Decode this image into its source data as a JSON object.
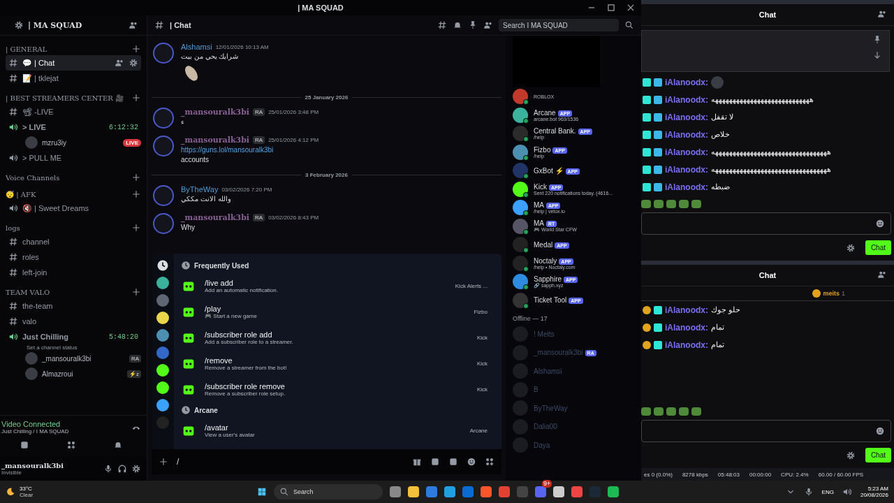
{
  "window": {
    "title": "| MA SQUAD"
  },
  "server": {
    "name": "| MA SQUAD"
  },
  "sidebar": {
    "sections": [
      {
        "label": "| GENERAL",
        "channels": [
          {
            "kind": "text",
            "name": "💬 | Chat",
            "selected": true
          },
          {
            "kind": "text",
            "name": "📝 | tklejat",
            "selected": false
          }
        ]
      },
      {
        "label": "| BEST STREAMERS CENTER 🎥",
        "channels": [
          {
            "kind": "text",
            "name": "📽 -LIVE",
            "selected": false
          },
          {
            "kind": "voice",
            "name": "> LIVE",
            "active": true,
            "timer": "6:12:32",
            "users": [
              {
                "name": "mzru3iy",
                "live": "LIVE"
              }
            ]
          },
          {
            "kind": "voice",
            "name": "> PULL ME",
            "active": false
          }
        ]
      },
      {
        "label": "Voice Channels"
      },
      {
        "label": "😴 | AFK",
        "channels": [
          {
            "kind": "voice",
            "name": "🔇 | Sweet Dreams",
            "active": false
          }
        ]
      },
      {
        "label": "logs",
        "channels": [
          {
            "kind": "text",
            "name": "channel",
            "selected": false
          },
          {
            "kind": "text",
            "name": "roles",
            "selected": false
          },
          {
            "kind": "text",
            "name": "left-join",
            "selected": false
          }
        ]
      },
      {
        "label": "TEAM VALO",
        "channels": [
          {
            "kind": "text",
            "name": "the-team",
            "selected": false
          },
          {
            "kind": "text",
            "name": "valo",
            "selected": false
          },
          {
            "kind": "voice",
            "name": "Just Chilling",
            "active": true,
            "timer": "5:48:20",
            "status": "Set a channel status",
            "users": [
              {
                "name": "_mansouralk3bi",
                "tag": "RA"
              },
              {
                "name": "Almazroui",
                "tag": "⚡z"
              }
            ]
          }
        ]
      }
    ]
  },
  "voice_panel": {
    "status": "Video Connected",
    "location": "Just Chilling / I MA SQUAD"
  },
  "user_panel": {
    "name": "_mansouralk3bi",
    "status": "Invisible"
  },
  "header": {
    "channel": "| Chat",
    "search": {
      "placeholder": "Search I MA SQUAD"
    }
  },
  "messages": [
    {
      "kind": "message",
      "author": "Alshamsi",
      "time": "12/01/2026 10:13 AM",
      "lines": [
        "شرايك يحي من بيت"
      ],
      "sticker": true
    },
    {
      "kind": "divider",
      "label": "25 January 2026"
    },
    {
      "kind": "message",
      "author": "_mansouralk3bi",
      "tag": "RA",
      "time": "25/01/2026 3:48 PM",
      "lines": [
        "ء"
      ]
    },
    {
      "kind": "message",
      "author": "_mansouralk3bi",
      "tag": "RA",
      "time": "25/01/2026 4:12 PM",
      "link": "https://guns.lol/mansouralk3bi",
      "lines": [
        "accounts"
      ]
    },
    {
      "kind": "divider",
      "label": "3 February 2026"
    },
    {
      "kind": "message",
      "author": "ByTheWay",
      "time": "03/02/2026 7:20 PM",
      "lines": [
        "والله الانت مككي"
      ]
    },
    {
      "kind": "message",
      "author": "_mansouralk3bi",
      "tag": "RA",
      "time": "03/02/2026 8:43 PM",
      "lines": [
        "Why"
      ]
    }
  ],
  "commands": {
    "sections": [
      {
        "title": "Frequently Used",
        "items": [
          {
            "name": "/live add",
            "description": "Add an automatic notification.",
            "source": "Kick Alerts ..."
          },
          {
            "name": "/play",
            "description": "🎮 Start a new game",
            "source": "Fizbo"
          },
          {
            "name": "/subscriber role add",
            "description": "Add a subscriber role to a streamer.",
            "source": "Kick"
          },
          {
            "name": "/remove",
            "description": "Remove a streamer from the bot!",
            "source": "Kick"
          },
          {
            "name": "/subscriber role remove",
            "description": "Remove a subscriber role setup.",
            "source": "Kick"
          }
        ]
      },
      {
        "title": "Arcane",
        "items": [
          {
            "name": "/avatar",
            "description": "View a user's avatar",
            "source": "Arcane"
          }
        ]
      }
    ]
  },
  "composer": {
    "value": "/"
  },
  "members": {
    "online": [
      {
        "activity": "ROBLOX"
      },
      {
        "name": "Arcane",
        "badge": "APP",
        "activity": "arcane.bot 963/1536"
      },
      {
        "name": "Central Bank.",
        "badge": "APP",
        "activity": "/help"
      },
      {
        "name": "Fizbo",
        "badge": "APP",
        "activity": "/help"
      },
      {
        "name": "GxBot ⚡",
        "badge": "APP"
      },
      {
        "name": "Kick",
        "badge": "APP",
        "activity": "Sent 220 notifications today. (4616..."
      },
      {
        "name": "MA",
        "badge": "APP",
        "activity": "/help | vetox.io"
      },
      {
        "name": "MA",
        "badge": "RT",
        "activity": "🎮 World Star CFW"
      },
      {
        "name": "Medal",
        "badge": "APP"
      },
      {
        "name": "Noctaly",
        "badge": "APP",
        "activity": "/help • Noctaly.com"
      },
      {
        "name": "Sapphire",
        "badge": "APP",
        "activity": "🔗 sapph.xyz"
      },
      {
        "name": "Ticket Tool",
        "badge": "APP"
      }
    ],
    "offline_heading": "Offline — 17",
    "offline": [
      {
        "name": "! Meits"
      },
      {
        "name": "_mansouralk3bi",
        "badge": "RA"
      },
      {
        "name": "Alshamsi"
      },
      {
        "name": "B"
      },
      {
        "name": "ByTheWay"
      },
      {
        "name": "Dalia00"
      },
      {
        "name": "Daya"
      }
    ]
  },
  "docks": [
    {
      "title": "Chat",
      "pinned": true,
      "messages": [
        {
          "user": "iAlanoodx:"
        },
        {
          "user": "iAlanoodx:",
          "text": "ههههههههههههههههههههههههههههه"
        },
        {
          "user": "iAlanoodx:",
          "text": "لا تقفل"
        },
        {
          "user": "iAlanoodx:",
          "text": "خلاص"
        },
        {
          "user": "iAlanoodx:",
          "text": "هههههههههههههههههههههههههههههههههه"
        },
        {
          "user": "iAlanoodx:",
          "text": "هههههههههههههههههههههههههههههههههه"
        },
        {
          "user": "iAlanoodx:",
          "text": "ضبطه"
        }
      ],
      "send": "Chat"
    },
    {
      "title": "Chat",
      "pinned": false,
      "leader": {
        "name": "meits",
        "count": "1"
      },
      "messages": [
        {
          "user": "iAlanoodx:",
          "text": "حلو جوك"
        },
        {
          "user": "iAlanoodx:",
          "text": "تمام"
        },
        {
          "user": "iAlanoodx:",
          "text": "تمام"
        }
      ],
      "send": "Chat"
    }
  ],
  "stats_bar": [
    "es 0 (0.0%)",
    "8278 kbps",
    "05:48:03",
    "00:00:00",
    "CPU: 2.4%",
    "60.00 / 60.00 FPS"
  ],
  "taskbar": {
    "weather": {
      "temp": "33°C",
      "condition": "Clear"
    },
    "search": "Search",
    "notification_badge": "9+",
    "language": "ENG",
    "time": "5:23 AM",
    "date": "20/08/2026"
  }
}
